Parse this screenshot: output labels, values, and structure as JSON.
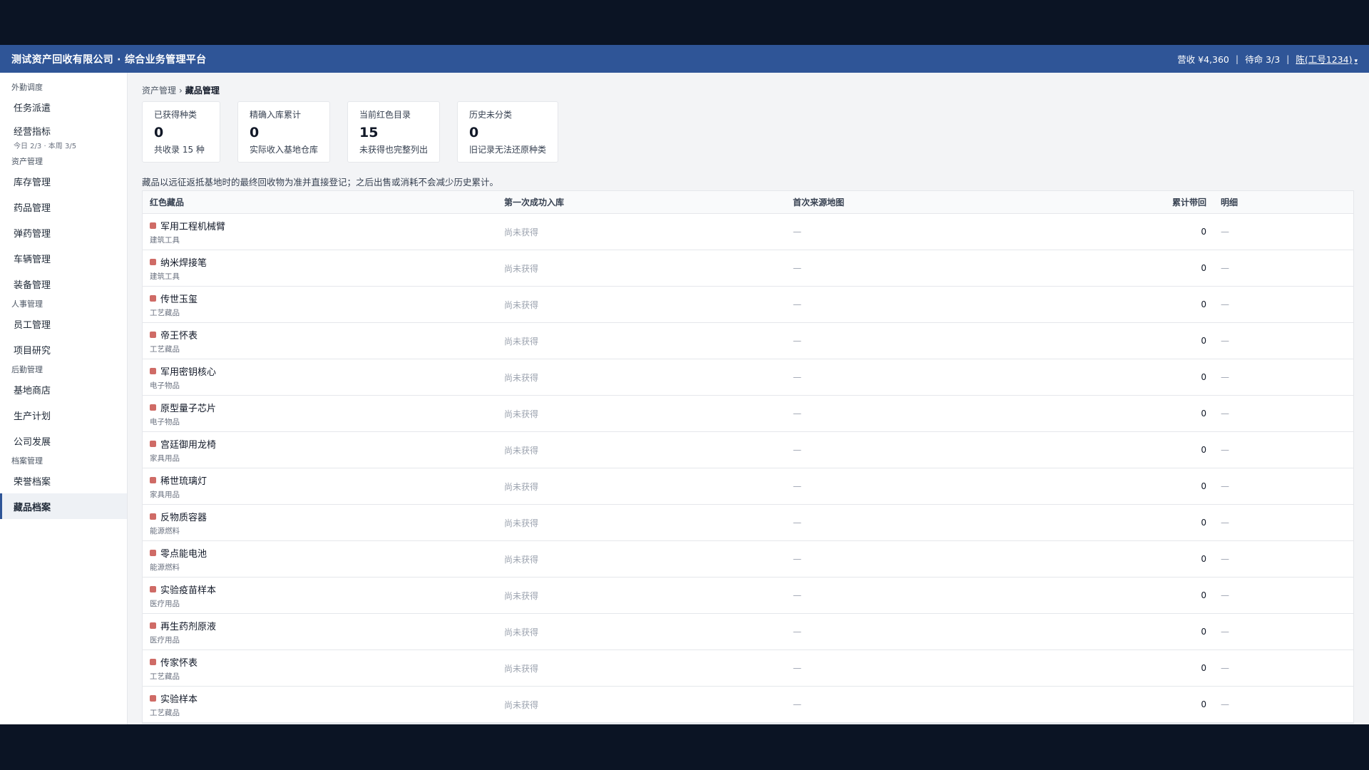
{
  "header": {
    "title": "测试资产回收有限公司 · 综合业务管理平台",
    "revenue": "营收 ¥4,360",
    "lives": "待命 3/3",
    "separator": "|",
    "user": "陈(工号1234)",
    "caret": "▾"
  },
  "sidebar": {
    "groups": [
      {
        "title": "外勤调度",
        "items": [
          {
            "label": "任务派遣"
          },
          {
            "label": "经营指标",
            "sub": "今日 2/3 · 本周 3/5"
          }
        ]
      },
      {
        "title": "资产管理",
        "items": [
          {
            "label": "库存管理"
          },
          {
            "label": "药品管理"
          },
          {
            "label": "弹药管理"
          },
          {
            "label": "车辆管理"
          },
          {
            "label": "装备管理"
          }
        ]
      },
      {
        "title": "人事管理",
        "items": [
          {
            "label": "员工管理"
          },
          {
            "label": "项目研究"
          }
        ]
      },
      {
        "title": "后勤管理",
        "items": [
          {
            "label": "基地商店"
          },
          {
            "label": "生产计划"
          },
          {
            "label": "公司发展"
          }
        ]
      },
      {
        "title": "档案管理",
        "items": [
          {
            "label": "荣誉档案"
          },
          {
            "label": "藏品档案",
            "active": true
          }
        ]
      }
    ]
  },
  "breadcrumb": {
    "parent": "资产管理",
    "arrow": "›",
    "current": "藏品管理"
  },
  "stats": [
    {
      "label": "已获得种类",
      "value": "0",
      "desc": "共收录 15 种"
    },
    {
      "label": "精确入库累计",
      "value": "0",
      "desc": "实际收入基地仓库"
    },
    {
      "label": "当前红色目录",
      "value": "15",
      "desc": "未获得也完整列出"
    },
    {
      "label": "历史未分类",
      "value": "0",
      "desc": "旧记录无法还原种类"
    }
  ],
  "note": "藏品以远征返抵基地时的最终回收物为准并直接登记；之后出售或消耗不会减少历史累计。",
  "table": {
    "headers": [
      "红色藏品",
      "第一次成功入库",
      "首次来源地图",
      "累计带回",
      "明细"
    ],
    "rows": [
      {
        "name": "军用工程机械臂",
        "category": "建筑工具",
        "first": "尚未获得",
        "map": "—",
        "count": "0",
        "detail": "—"
      },
      {
        "name": "纳米焊接笔",
        "category": "建筑工具",
        "first": "尚未获得",
        "map": "—",
        "count": "0",
        "detail": "—"
      },
      {
        "name": "传世玉玺",
        "category": "工艺藏品",
        "first": "尚未获得",
        "map": "—",
        "count": "0",
        "detail": "—"
      },
      {
        "name": "帝王怀表",
        "category": "工艺藏品",
        "first": "尚未获得",
        "map": "—",
        "count": "0",
        "detail": "—"
      },
      {
        "name": "军用密钥核心",
        "category": "电子物品",
        "first": "尚未获得",
        "map": "—",
        "count": "0",
        "detail": "—"
      },
      {
        "name": "原型量子芯片",
        "category": "电子物品",
        "first": "尚未获得",
        "map": "—",
        "count": "0",
        "detail": "—"
      },
      {
        "name": "宫廷御用龙椅",
        "category": "家具用品",
        "first": "尚未获得",
        "map": "—",
        "count": "0",
        "detail": "—"
      },
      {
        "name": "稀世琉璃灯",
        "category": "家具用品",
        "first": "尚未获得",
        "map": "—",
        "count": "0",
        "detail": "—"
      },
      {
        "name": "反物质容器",
        "category": "能源燃料",
        "first": "尚未获得",
        "map": "—",
        "count": "0",
        "detail": "—"
      },
      {
        "name": "零点能电池",
        "category": "能源燃料",
        "first": "尚未获得",
        "map": "—",
        "count": "0",
        "detail": "—"
      },
      {
        "name": "实验疫苗样本",
        "category": "医疗用品",
        "first": "尚未获得",
        "map": "—",
        "count": "0",
        "detail": "—"
      },
      {
        "name": "再生药剂原液",
        "category": "医疗用品",
        "first": "尚未获得",
        "map": "—",
        "count": "0",
        "detail": "—"
      },
      {
        "name": "传家怀表",
        "category": "工艺藏品",
        "first": "尚未获得",
        "map": "—",
        "count": "0",
        "detail": "—"
      },
      {
        "name": "实验样本",
        "category": "工艺藏品",
        "first": "尚未获得",
        "map": "—",
        "count": "0",
        "detail": "—"
      }
    ]
  },
  "colors": {
    "header_bg": "#2f5597",
    "swatch": "#cf6b66",
    "page_bg": "#f3f4f6"
  }
}
